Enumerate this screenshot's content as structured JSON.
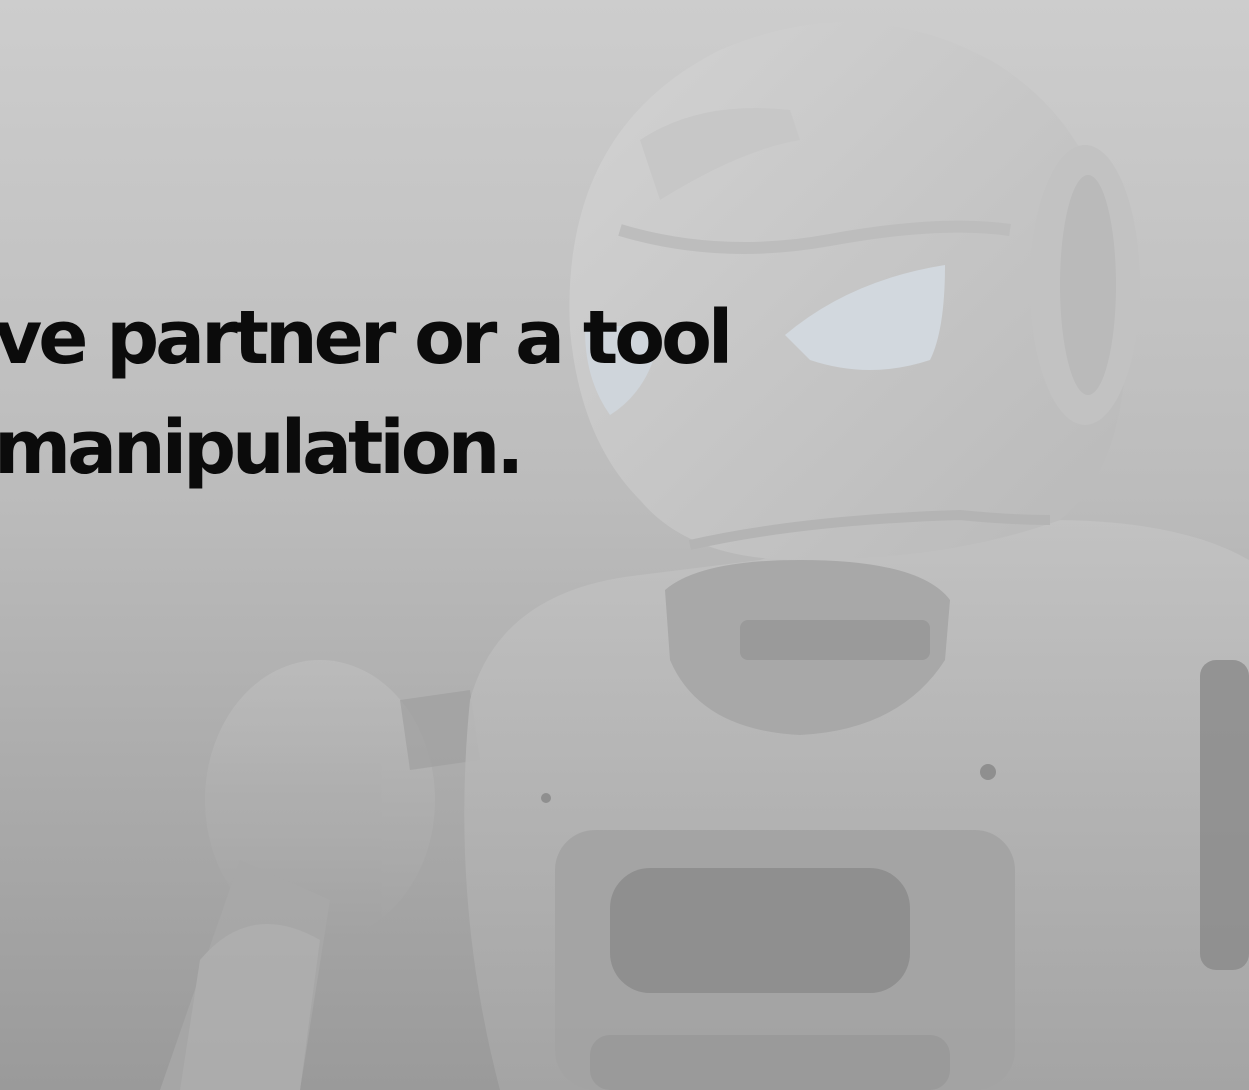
{
  "headline": {
    "line1": "ve partner or a tool",
    "line2": "manipulation."
  },
  "background": {
    "image": "robot-illustration",
    "colors": {
      "top": "#cdcdcd",
      "bottom": "#9a9a9a",
      "robot_light": "#d4d4d4",
      "robot_shadow": "#a6a6a6",
      "eye_tint": "#d2d8de"
    }
  }
}
